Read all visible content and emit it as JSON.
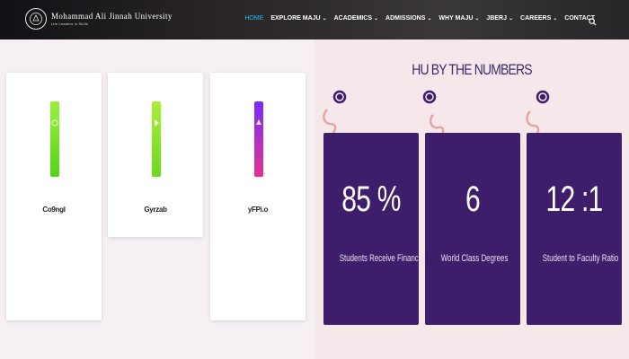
{
  "header": {
    "logo_emblem": "MAJU",
    "logo_title": "Mohammad Ali Jinnah University",
    "logo_sub": "Life Leaders in Skills"
  },
  "nav": {
    "items": [
      {
        "label": "HOME",
        "dropdown": false,
        "active": true
      },
      {
        "label": "EXPLORE MAJU",
        "dropdown": true,
        "active": false
      },
      {
        "label": "ACADEMICS",
        "dropdown": true,
        "active": false
      },
      {
        "label": "ADMISSIONS",
        "dropdown": true,
        "active": false
      },
      {
        "label": "WHY MAJU",
        "dropdown": true,
        "active": false
      },
      {
        "label": "JBERJ",
        "dropdown": true,
        "active": false
      },
      {
        "label": "CAREERS",
        "dropdown": true,
        "active": false
      },
      {
        "label": "CONTACT",
        "dropdown": false,
        "active": false
      }
    ],
    "search_icon": "search-icon",
    "accent_color": "#27b9e9"
  },
  "cards": [
    {
      "label": "Co9ngl",
      "icon": "green-search-icon",
      "color": "#6fdc1f"
    },
    {
      "label": "Gyrzab",
      "icon": "green-play-icon",
      "color": "#8be22b"
    },
    {
      "label": "yFPi.o",
      "icon": "gradient-up-icon",
      "color": "#8b2dff"
    }
  ],
  "numbers": {
    "title": "HU BY THE NUMBERS",
    "color": "#3e1d6b",
    "stats": [
      {
        "value": "85 %",
        "label": "Students Receive Financial Support"
      },
      {
        "value": "6",
        "label": "World Class Degrees"
      },
      {
        "value": "12 :1",
        "label": "Student to Faculty Ratio"
      }
    ]
  }
}
